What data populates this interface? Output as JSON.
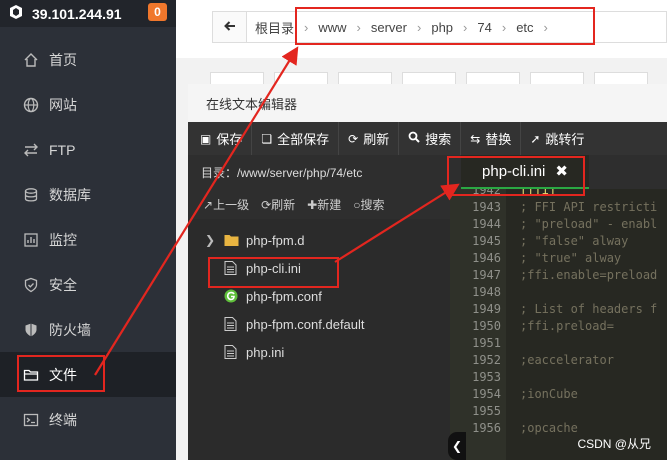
{
  "sidebar": {
    "server_ip": "39.101.244.91",
    "badge": "0",
    "items": [
      {
        "label": "首页",
        "icon": "home-icon"
      },
      {
        "label": "网站",
        "icon": "globe-icon"
      },
      {
        "label": "FTP",
        "icon": "ftp-icon"
      },
      {
        "label": "数据库",
        "icon": "database-icon"
      },
      {
        "label": "监控",
        "icon": "monitor-icon"
      },
      {
        "label": "安全",
        "icon": "shield-icon"
      },
      {
        "label": "防火墙",
        "icon": "firewall-icon"
      },
      {
        "label": "文件",
        "icon": "folder-icon"
      },
      {
        "label": "终端",
        "icon": "terminal-icon"
      }
    ]
  },
  "breadcrumb": [
    "根目录",
    "www",
    "server",
    "php",
    "74",
    "etc"
  ],
  "editor": {
    "title": "在线文本编辑器",
    "tools": [
      {
        "label": "保存",
        "icon": "save-icon"
      },
      {
        "label": "全部保存",
        "icon": "save-all-icon"
      },
      {
        "label": "刷新",
        "icon": "refresh-icon"
      },
      {
        "label": "搜索",
        "icon": "search-icon"
      },
      {
        "label": "替换",
        "icon": "replace-icon"
      },
      {
        "label": "跳转行",
        "icon": "goto-line-icon"
      }
    ],
    "directory": "目录：/www/server/php/74/etc",
    "active_tab": "php-cli.ini",
    "file_actions": [
      "上一级",
      "刷新",
      "新建",
      "搜索"
    ],
    "files": [
      {
        "name": "php-fpm.d",
        "type": "folder"
      },
      {
        "name": "php-cli.ini",
        "type": "file"
      },
      {
        "name": "php-fpm.conf",
        "type": "config"
      },
      {
        "name": "php-fpm.conf.default",
        "type": "file"
      },
      {
        "name": "php.ini",
        "type": "file"
      }
    ],
    "code": [
      {
        "line": "1942",
        "text": "[ffi]"
      },
      {
        "line": "1943",
        "text": "; FFI API restricti"
      },
      {
        "line": "1944",
        "text": "; \"preload\" - enabl"
      },
      {
        "line": "1945",
        "text": "; \"false\"   alway"
      },
      {
        "line": "1946",
        "text": "; \"true\"    alway"
      },
      {
        "line": "1947",
        "text": ";ffi.enable=preload"
      },
      {
        "line": "1948",
        "text": ""
      },
      {
        "line": "1949",
        "text": "; List of headers f"
      },
      {
        "line": "1950",
        "text": ";ffi.preload="
      },
      {
        "line": "1951",
        "text": ""
      },
      {
        "line": "1952",
        "text": ";eaccelerator"
      },
      {
        "line": "1953",
        "text": ""
      },
      {
        "line": "1954",
        "text": ";ionCube"
      },
      {
        "line": "1955",
        "text": ""
      },
      {
        "line": "1956",
        "text": ";opcache"
      }
    ]
  },
  "watermark": "CSDN @从兄",
  "colors": {
    "annotation": "#e3261f",
    "tab_underline": "#2aa843",
    "badge": "#f0772c"
  }
}
